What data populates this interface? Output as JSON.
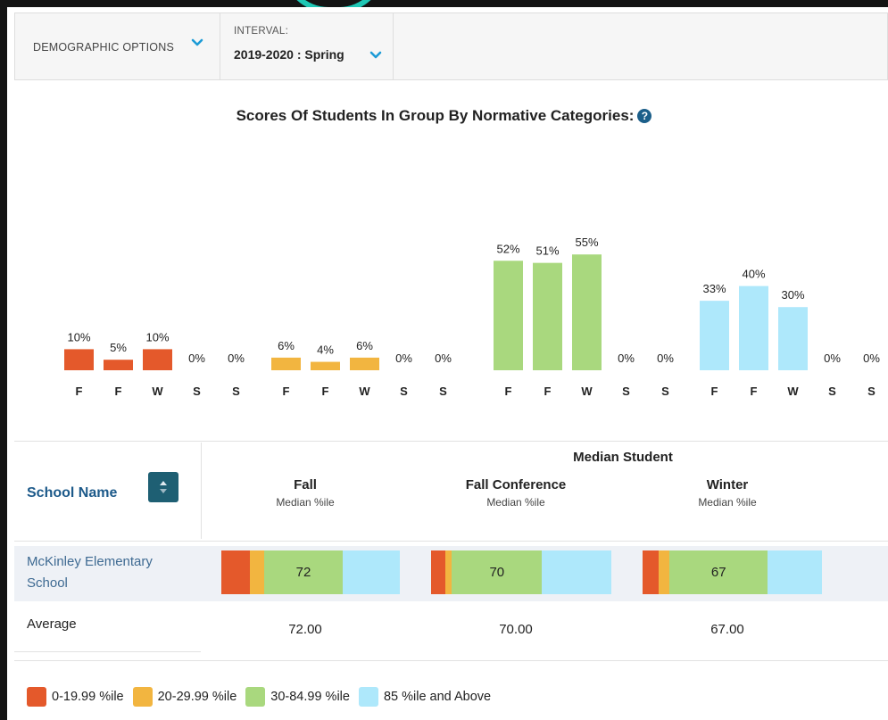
{
  "toolbar": {
    "demographic_label": "DEMOGRAPHIC OPTIONS",
    "interval_caption": "INTERVAL:",
    "interval_value": "2019-2020 : Spring"
  },
  "colors": {
    "cat1": "#e4592b",
    "cat2": "#f2b540",
    "cat3": "#a9d87e",
    "cat4": "#aee8fb",
    "accent": "#1d9bd6"
  },
  "chart_data": {
    "type": "bar",
    "title": "Scores Of Students In Group By Normative Categories:",
    "categories": [
      "F",
      "F",
      "W",
      "S",
      "S"
    ],
    "series": [
      {
        "name": "0-19.99 %ile",
        "color": "#e4592b",
        "values": [
          10,
          5,
          10,
          0,
          0
        ],
        "labels": [
          "10%",
          "5%",
          "10%",
          "0%",
          "0%"
        ]
      },
      {
        "name": "20-29.99 %ile",
        "color": "#f2b540",
        "values": [
          6,
          4,
          6,
          0,
          0
        ],
        "labels": [
          "6%",
          "4%",
          "6%",
          "0%",
          "0%"
        ]
      },
      {
        "name": "30-84.99 %ile",
        "color": "#a9d87e",
        "values": [
          52,
          51,
          55,
          0,
          0
        ],
        "labels": [
          "52%",
          "51%",
          "55%",
          "0%",
          "0%"
        ]
      },
      {
        "name": "85 %ile and Above",
        "color": "#aee8fb",
        "values": [
          33,
          40,
          30,
          0,
          0
        ],
        "labels": [
          "33%",
          "40%",
          "30%",
          "0%",
          "0%"
        ]
      }
    ],
    "ylim": [
      0,
      60
    ],
    "grid": false
  },
  "table": {
    "school_name_header": "School Name",
    "median_header": "Median Student",
    "columns": [
      {
        "title": "Fall",
        "subtitle": "Median %ile"
      },
      {
        "title": "Fall Conference",
        "subtitle": "Median %ile"
      },
      {
        "title": "Winter",
        "subtitle": "Median %ile"
      }
    ],
    "school": {
      "name": "McKinley Elementary School",
      "bars": [
        {
          "median": "72",
          "shares": [
            4,
            2,
            11,
            8
          ]
        },
        {
          "median": "70",
          "shares": [
            2,
            1,
            13,
            10
          ]
        },
        {
          "median": "67",
          "shares": [
            3,
            2,
            18,
            10
          ]
        }
      ]
    },
    "average": {
      "label": "Average",
      "values": [
        "72.00",
        "70.00",
        "67.00"
      ]
    }
  },
  "legend": [
    {
      "label": "0-19.99 %ile",
      "color": "#e4592b"
    },
    {
      "label": "20-29.99 %ile",
      "color": "#f2b540"
    },
    {
      "label": "30-84.99 %ile",
      "color": "#a9d87e"
    },
    {
      "label": "85 %ile and Above",
      "color": "#aee8fb"
    }
  ]
}
